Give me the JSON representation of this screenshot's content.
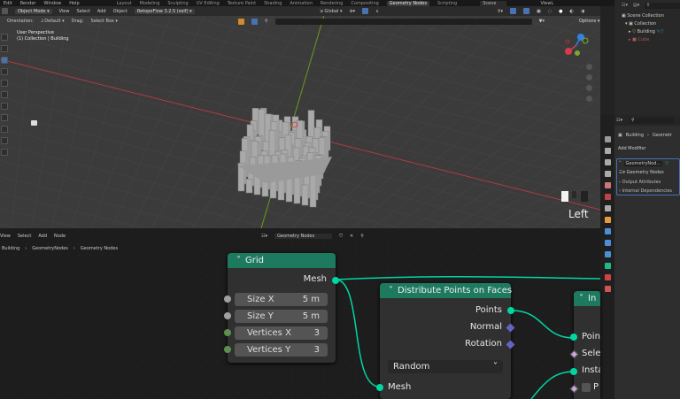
{
  "topbar": {
    "menus": [
      "Edit",
      "Render",
      "Window",
      "Help"
    ],
    "workspaces": [
      "Layout",
      "Modeling",
      "Sculpting",
      "UV Editing",
      "Texture Paint",
      "Shading",
      "Animation",
      "Rendering",
      "Compositing",
      "Geometry Nodes",
      "Scripting"
    ],
    "active_workspace": "Geometry Nodes",
    "scene": "Scene",
    "view_layer": "ViewL"
  },
  "viewport": {
    "mode": "Object Mode",
    "menus": [
      "View",
      "Select",
      "Add",
      "Object"
    ],
    "addon": "RetopoFlow 3.2.5 (self)",
    "orientation_label": "Orientation:",
    "orientation": "Default",
    "drag_label": "Drag:",
    "drag": "Select Box",
    "transform": "Global",
    "options": "Options",
    "overlay_line1": "User Perspective",
    "overlay_line2": "(1) Collection | Building",
    "view_name": "Left"
  },
  "outliner": {
    "items": [
      {
        "label": "Scene Collection"
      },
      {
        "label": "Collection"
      },
      {
        "label": "Building"
      },
      {
        "label": "Cube"
      }
    ]
  },
  "properties": {
    "breadcrumb": [
      "Building",
      "Geometr"
    ],
    "add_modifier": "Add Modifier",
    "modifier_name": "GeometryNod...",
    "node_group": "Geometry Nodes",
    "panels": [
      "Output Attributes",
      "Internal Dependencies"
    ]
  },
  "node_editor": {
    "menus": [
      "View",
      "Select",
      "Add",
      "Node"
    ],
    "node_tree": "Geometry Nodes",
    "breadcrumb": [
      "Building",
      "GeometryNodes",
      "Geometry Nodes"
    ]
  },
  "nodes": {
    "grid": {
      "title": "Grid",
      "output": "Mesh",
      "fields": [
        {
          "label": "Size X",
          "value": "5 m"
        },
        {
          "label": "Size Y",
          "value": "5 m"
        },
        {
          "label": "Vertices X",
          "value": "3"
        },
        {
          "label": "Vertices Y",
          "value": "3"
        }
      ]
    },
    "distribute": {
      "title": "Distribute Points on Faces",
      "outputs": [
        "Points",
        "Normal",
        "Rotation"
      ],
      "mode": "Random",
      "input": "Mesh"
    },
    "instance": {
      "title": "In",
      "inputs": [
        "Poin",
        "Sele",
        "Insta",
        "P"
      ]
    }
  },
  "colors": {
    "node_header": "#1e7a5f",
    "geometry_socket": "#00d6a3",
    "vector_socket": "#6363c7",
    "accent": "#4772b3",
    "x_axis": "#b13a44",
    "y_axis": "#6b9a1f"
  }
}
